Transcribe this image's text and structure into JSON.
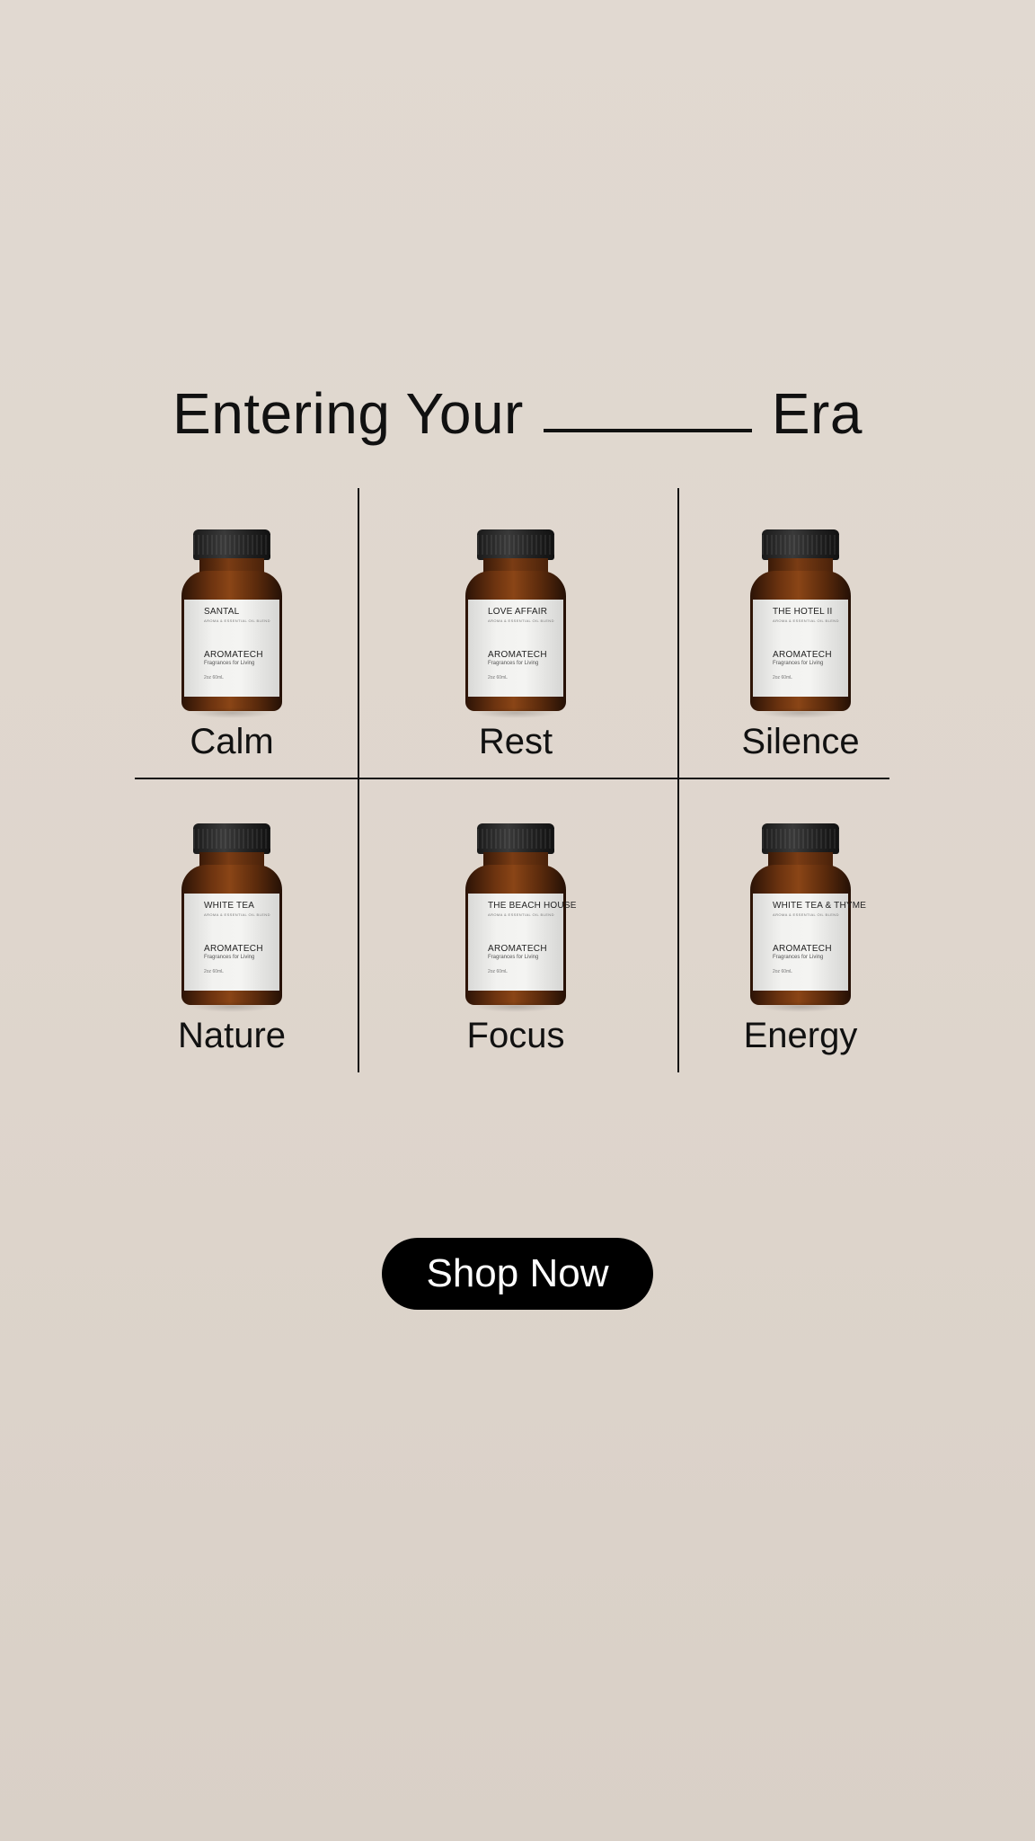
{
  "headline": {
    "prefix": "Entering Your",
    "suffix": "Era"
  },
  "products": [
    {
      "product_name": "SANTAL",
      "tagline": "AROMA & ESSENTIAL OIL BLEND",
      "brand": "AROMATECH",
      "brand_sub": "Fragrances for Living",
      "size": "2oz 60mL",
      "mood": "Calm"
    },
    {
      "product_name": "LOVE AFFAIR",
      "tagline": "AROMA & ESSENTIAL OIL BLEND",
      "brand": "AROMATECH",
      "brand_sub": "Fragrances for Living",
      "size": "2oz 60mL",
      "mood": "Rest"
    },
    {
      "product_name": "THE HOTEL II",
      "tagline": "AROMA & ESSENTIAL OIL BLEND",
      "brand": "AROMATECH",
      "brand_sub": "Fragrances for Living",
      "size": "2oz 60mL",
      "mood": "Silence"
    },
    {
      "product_name": "WHITE TEA",
      "tagline": "AROMA & ESSENTIAL OIL BLEND",
      "brand": "AROMATECH",
      "brand_sub": "Fragrances for Living",
      "size": "2oz 60mL",
      "mood": "Nature"
    },
    {
      "product_name": "THE BEACH HOUSE",
      "tagline": "AROMA & ESSENTIAL OIL BLEND",
      "brand": "AROMATECH",
      "brand_sub": "Fragrances for Living",
      "size": "2oz 60mL",
      "mood": "Focus"
    },
    {
      "product_name": "WHITE TEA & THYME",
      "tagline": "AROMA & ESSENTIAL OIL BLEND",
      "brand": "AROMATECH",
      "brand_sub": "Fragrances for Living",
      "size": "2oz 60mL",
      "mood": "Energy"
    }
  ],
  "cta": {
    "label": "Shop Now"
  },
  "colors": {
    "background": "#dfd6cd",
    "text": "#111111",
    "button_bg": "#000000",
    "button_text": "#ffffff",
    "amber": "#7a3c14"
  }
}
